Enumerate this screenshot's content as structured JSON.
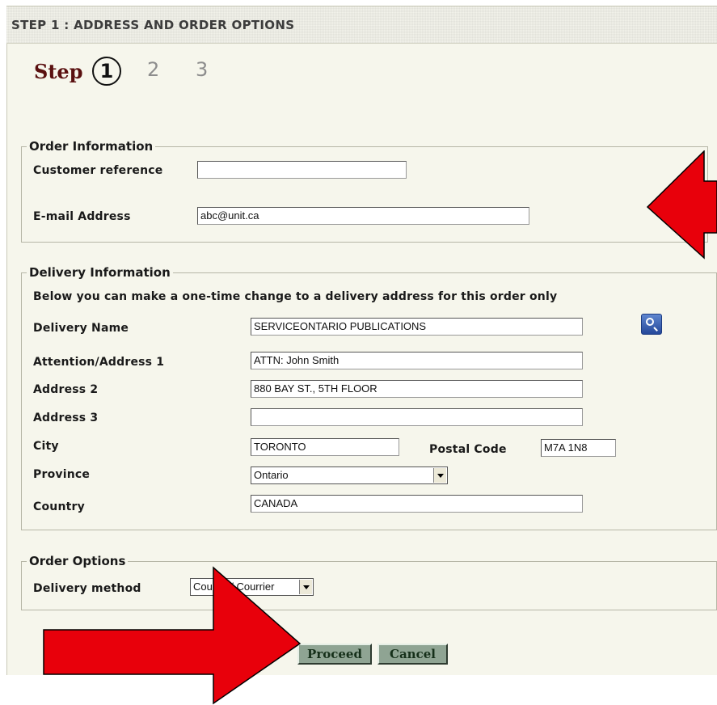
{
  "header": {
    "title": "STEP 1 : ADDRESS AND ORDER OPTIONS"
  },
  "steps": {
    "label": "Step",
    "current": "1",
    "next": [
      "2",
      "3"
    ]
  },
  "order_info": {
    "legend": "Order Information",
    "customer_reference_label": "Customer reference",
    "customer_reference_value": "",
    "email_label": "E-mail Address",
    "email_value": "abc@unit.ca"
  },
  "delivery_info": {
    "legend": "Delivery Information",
    "note": "Below you can make a one-time change to a delivery address for this order only",
    "delivery_name_label": "Delivery Name",
    "delivery_name_value": "SERVICEONTARIO PUBLICATIONS",
    "address1_label": "Attention/Address 1",
    "address1_value": "ATTN: John Smith",
    "address2_label": "Address 2",
    "address2_value": "880 BAY ST., 5TH FLOOR",
    "address3_label": "Address 3",
    "address3_value": "",
    "city_label": "City",
    "city_value": "TORONTO",
    "postal_code_label": "Postal Code",
    "postal_code_value": "M7A 1N8",
    "province_label": "Province",
    "province_value": "Ontario",
    "country_label": "Country",
    "country_value": "CANADA"
  },
  "order_options": {
    "legend": "Order Options",
    "delivery_method_label": "Delivery method",
    "delivery_method_value": "Courier / Courrier"
  },
  "buttons": {
    "proceed": "Proceed",
    "cancel": "Cancel"
  },
  "colors": {
    "arrow": "#e8000b",
    "panel_bg": "#f6f6ec",
    "button_bg": "#8fa493",
    "step_label": "#5a1010"
  },
  "icons": {
    "lookup": "magnifier-icon",
    "annotation_arrows": [
      "left-arrow-icon",
      "right-arrow-icon"
    ]
  }
}
